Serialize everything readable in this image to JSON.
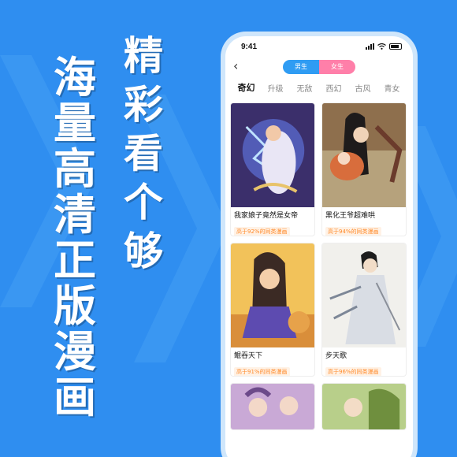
{
  "headline": {
    "main_chars": [
      "海",
      "量",
      "高",
      "清",
      "正",
      "版",
      "漫",
      "画"
    ],
    "side_chars": [
      "精",
      "彩",
      "看",
      "个",
      "够"
    ]
  },
  "status_bar": {
    "time": "9:41"
  },
  "top_bar": {
    "back_icon": "chevron-left-icon",
    "male_label": "男生",
    "female_label": "女生"
  },
  "genre_tabs": [
    {
      "label": "奇幻",
      "active": true
    },
    {
      "label": "升级",
      "active": false
    },
    {
      "label": "无敌",
      "active": false
    },
    {
      "label": "西幻",
      "active": false
    },
    {
      "label": "古风",
      "active": false
    },
    {
      "label": "青女",
      "active": false
    }
  ],
  "comics": [
    {
      "title": "我家娘子竟然是女帝",
      "tag": "高于92%的同类漫画"
    },
    {
      "title": "黑化王爷超难哄",
      "tag": "高于94%的同类漫画"
    },
    {
      "title": "鲲吞天下",
      "tag": "高于91%的同类漫画"
    },
    {
      "title": "步天歌",
      "tag": "高于96%的同类漫画"
    }
  ],
  "colors": {
    "background": "#2f8ef0",
    "accent_blue": "#2f9cf3",
    "accent_pink": "#ff7fa9",
    "tag_orange": "#ff8a2a"
  }
}
